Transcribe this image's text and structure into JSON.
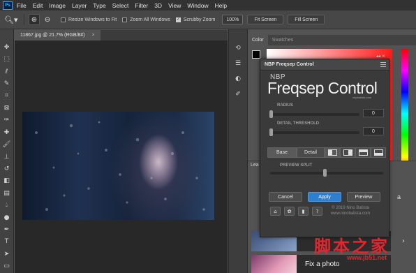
{
  "menubar": {
    "logo": "Ps",
    "items": [
      "File",
      "Edit",
      "Image",
      "Layer",
      "Type",
      "Select",
      "Filter",
      "3D",
      "View",
      "Window",
      "Help"
    ]
  },
  "options_bar": {
    "resize_windows_label": "Resize Windows to Fit",
    "zoom_all_label": "Zoom All Windows",
    "scrubby_label": "Scrubby Zoom",
    "zoom_value": "100%",
    "fit_screen_label": "Fit Screen",
    "fill_screen_label": "Fill Screen"
  },
  "document": {
    "tab_title": "11867.jpg @ 21.7% (RGB/8#)",
    "close": "×"
  },
  "panels": {
    "color_tab": "Color",
    "swatches_tab": "Swatches",
    "learn_tab": "Lea",
    "learn_edge_text": "a",
    "card2_title": "Fix a photo"
  },
  "plugin": {
    "title": "NBP Freqsep Control",
    "brand_small": "NBP",
    "brand_large": "Freqsep Control",
    "brand_sub": "nbpbatista.com",
    "radius_label": "RADIUS",
    "radius_value": "0",
    "detail_label": "DETAIL THRESHOLD",
    "detail_value": "0",
    "base_label": "Base",
    "detail_btn_label": "Detail",
    "preview_split_label": "PREVIEW SPLIT",
    "cancel_label": "Cancel",
    "apply_label": "Apply",
    "preview_label": "Preview",
    "copyright_line1": "© 2019 Nino Batista",
    "copyright_line2": "www.ninobatista.com"
  },
  "watermark": {
    "chars": "脚本之家",
    "url": "www.jb51.net"
  },
  "colors": {
    "accent": "#2f7fd1",
    "menubar_bg": "#323232",
    "panel_bg": "#535353",
    "watermark": "#e2262e"
  }
}
